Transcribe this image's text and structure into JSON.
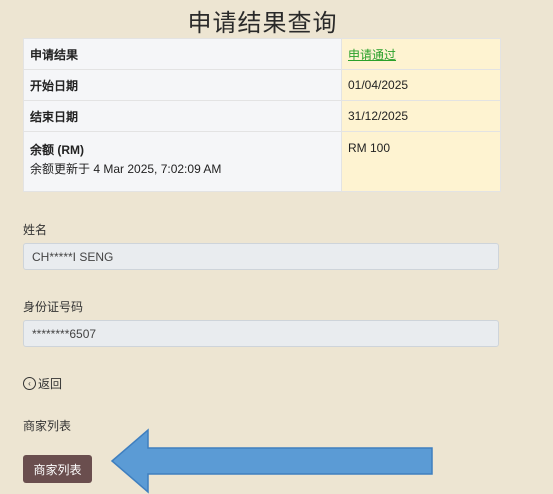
{
  "page": {
    "title": "申请结果查询"
  },
  "result_table": {
    "rows": [
      {
        "label": "申请结果",
        "value": "申请通过"
      },
      {
        "label": "开始日期",
        "value": "01/04/2025"
      },
      {
        "label": "结束日期",
        "value": "31/12/2025"
      },
      {
        "label": "余额 (RM)",
        "sublabel": "余额更新于 4 Mar 2025, 7:02:09 AM",
        "value": "RM 100"
      }
    ]
  },
  "fields": {
    "name": {
      "label": "姓名",
      "value": "CH*****I SENG"
    },
    "id_number": {
      "label": "身份证号码",
      "value": "********6507"
    }
  },
  "back": {
    "label": "返回",
    "icon": "back-circle-icon"
  },
  "merchant": {
    "heading": "商家列表",
    "button_label": "商家列表"
  },
  "colors": {
    "background": "#ede5d2",
    "value_cell": "#fef3d1",
    "approved_text": "#2aa12a",
    "button": "#6a4e4e",
    "arrow": "#5b9bd5"
  }
}
